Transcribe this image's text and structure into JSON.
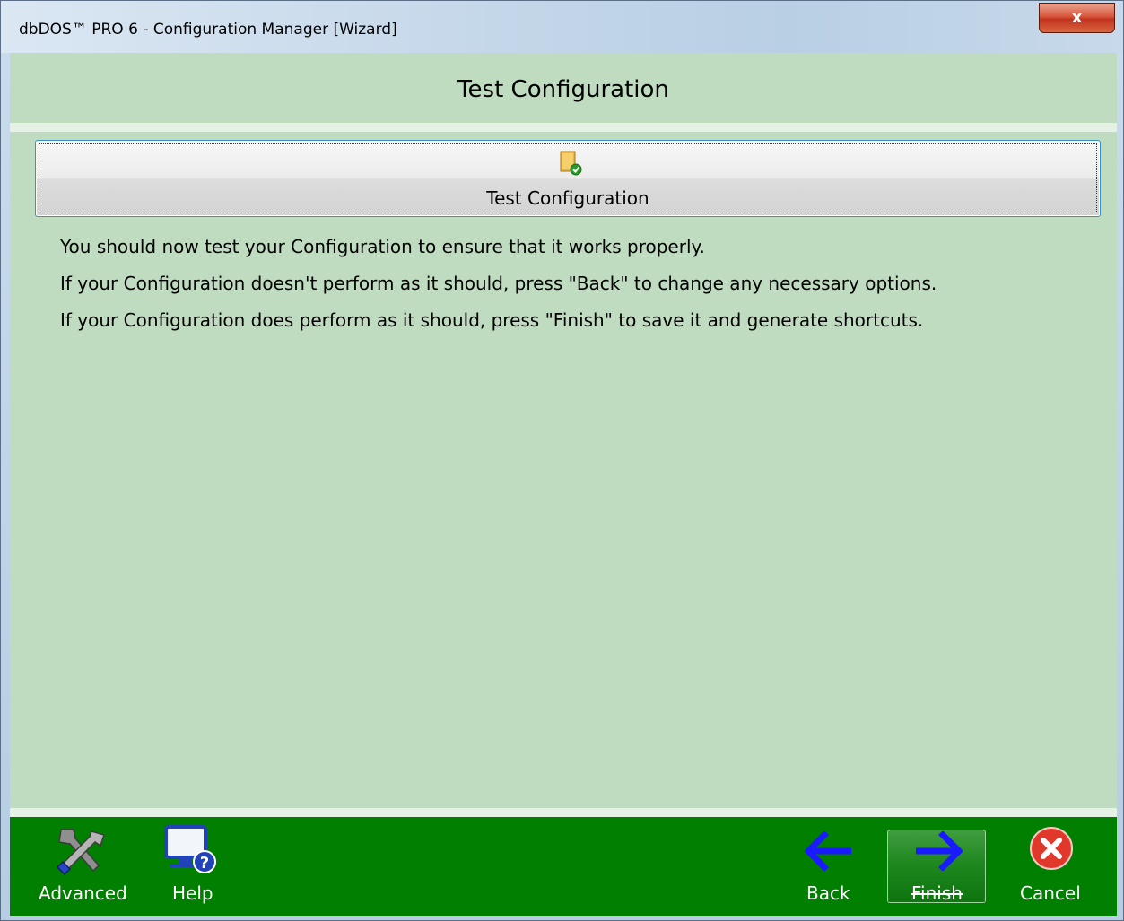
{
  "window": {
    "title": "dbDOS™ PRO 6 - Configuration Manager [Wizard]",
    "close_label": "x"
  },
  "header": {
    "title": "Test Configuration"
  },
  "test_button": {
    "label": "Test Configuration",
    "icon": "document-check-icon"
  },
  "info_lines": [
    "You should now test your Configuration to ensure that it works properly.",
    "If your Configuration doesn't perform as it should, press \"Back\" to change any necessary options.",
    "If your Configuration does perform as it should, press \"Finish\" to save it and generate shortcuts."
  ],
  "footer": {
    "advanced": {
      "label": "Advanced",
      "icon": "tools-icon"
    },
    "help": {
      "label": "Help",
      "icon": "monitor-help-icon"
    },
    "back": {
      "label": "Back",
      "icon": "arrow-left-icon"
    },
    "finish": {
      "label": "Finish",
      "icon": "arrow-right-icon"
    },
    "cancel": {
      "label": "Cancel",
      "icon": "cancel-icon"
    }
  },
  "colors": {
    "panel": "#c0dcc0",
    "footer": "#007f00",
    "arrow": "#1a1aff",
    "cancel": "#e0392b"
  }
}
